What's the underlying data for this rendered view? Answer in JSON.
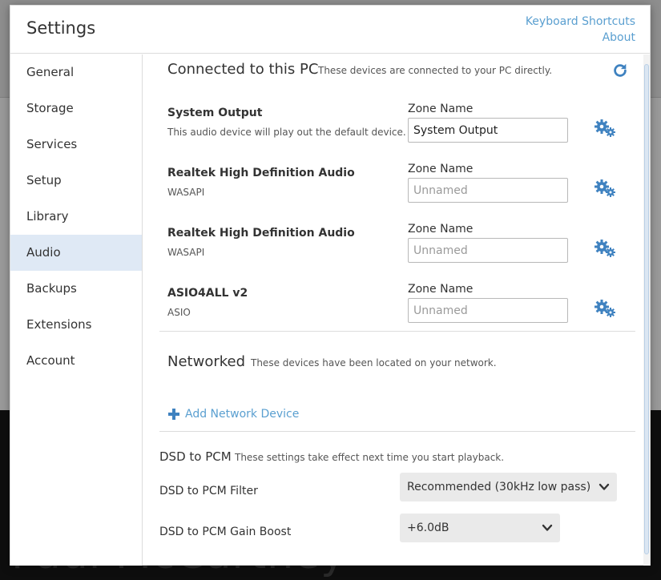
{
  "background": {
    "artist_text": "Paul McCartney"
  },
  "modal": {
    "title": "Settings",
    "links": {
      "keyboard_shortcuts": "Keyboard Shortcuts",
      "about": "About"
    }
  },
  "sidebar": {
    "active": "Audio",
    "items": [
      {
        "label": "General"
      },
      {
        "label": "Storage"
      },
      {
        "label": "Services"
      },
      {
        "label": "Setup"
      },
      {
        "label": "Library"
      },
      {
        "label": "Audio"
      },
      {
        "label": "Backups"
      },
      {
        "label": "Extensions"
      },
      {
        "label": "Account"
      }
    ]
  },
  "connected": {
    "title": "Connected to this PC",
    "description": "These devices are connected to your PC directly.",
    "refresh_icon": "refresh-icon",
    "devices": [
      {
        "name": "System Output",
        "sub": "This audio device will play out the default device.",
        "zone_label": "Zone Name",
        "zone_value": "System Output",
        "placeholder": "Unnamed"
      },
      {
        "name": "Realtek High Definition Audio",
        "sub": "WASAPI",
        "zone_label": "Zone Name",
        "zone_value": "",
        "placeholder": "Unnamed"
      },
      {
        "name": "Realtek High Definition Audio",
        "sub": "WASAPI",
        "zone_label": "Zone Name",
        "zone_value": "",
        "placeholder": "Unnamed"
      },
      {
        "name": "ASIO4ALL v2",
        "sub": "ASIO",
        "zone_label": "Zone Name",
        "zone_value": "",
        "placeholder": "Unnamed"
      }
    ]
  },
  "networked": {
    "title": "Networked",
    "description": "These devices have been located on your network.",
    "add_label": "Add Network Device"
  },
  "dsd": {
    "title": "DSD to PCM",
    "description": "These settings take effect next time you start playback.",
    "filter_label": "DSD to PCM Filter",
    "filter_value": "Recommended (30kHz low pass)",
    "gain_label": "DSD to PCM Gain Boost",
    "gain_value": "+6.0dB"
  },
  "colors": {
    "accent": "#5a9fd0",
    "active_bg": "#dfe9f5",
    "gear": "#3f82c0"
  }
}
